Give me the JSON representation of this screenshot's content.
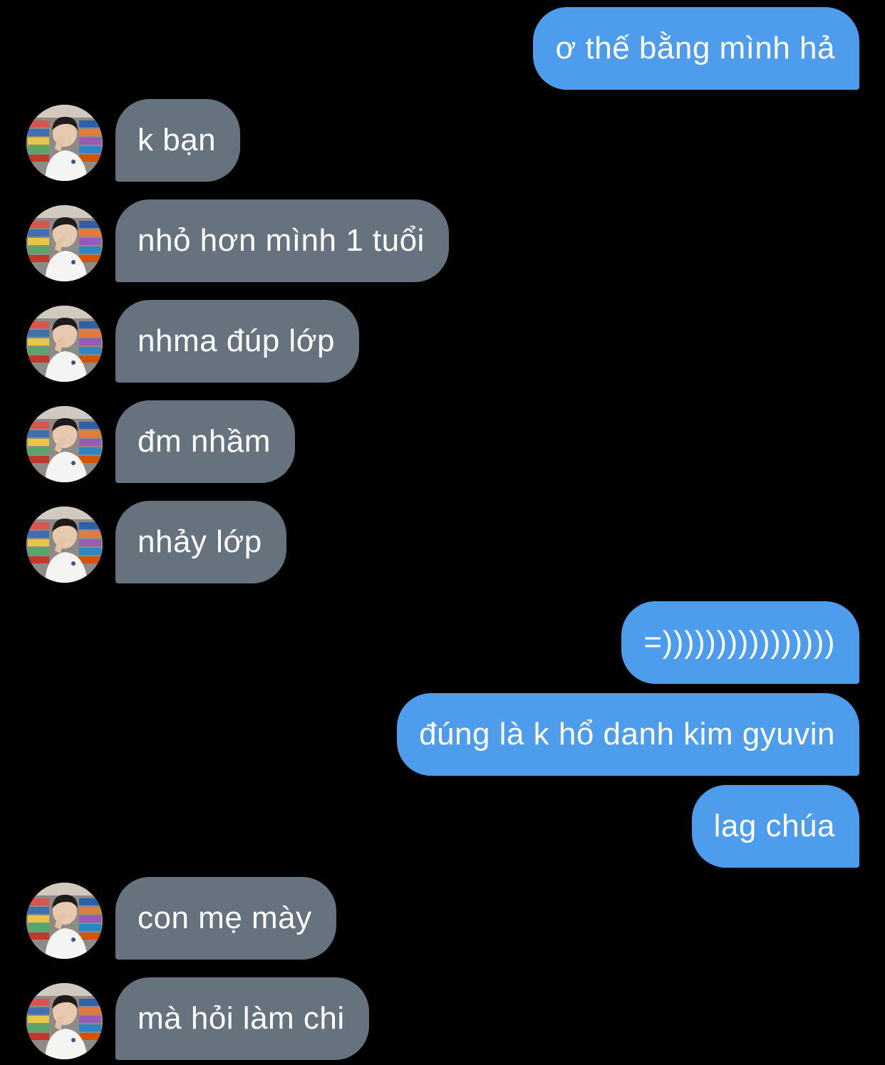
{
  "colors": {
    "background": "#000000",
    "sent_bubble": "#4e9ded",
    "received_bubble": "#66737f",
    "text": "#ffffff"
  },
  "messages": [
    {
      "from": "me",
      "text": "ơ thế bằng mình hả"
    },
    {
      "from": "other",
      "text": "k bạn"
    },
    {
      "from": "other",
      "text": "nhỏ hơn mình 1 tuổi"
    },
    {
      "from": "other",
      "text": "nhma đúp lớp"
    },
    {
      "from": "other",
      "text": "đm nhầm"
    },
    {
      "from": "other",
      "text": "nhảy lớp"
    },
    {
      "from": "me",
      "text": "=))))))))))))))))"
    },
    {
      "from": "me",
      "text": "đúng là k hổ danh kim gyuvin"
    },
    {
      "from": "me",
      "text": "lag chúa"
    },
    {
      "from": "other",
      "text": "con mẹ mày"
    },
    {
      "from": "other",
      "text": "mà hỏi làm chi"
    }
  ]
}
